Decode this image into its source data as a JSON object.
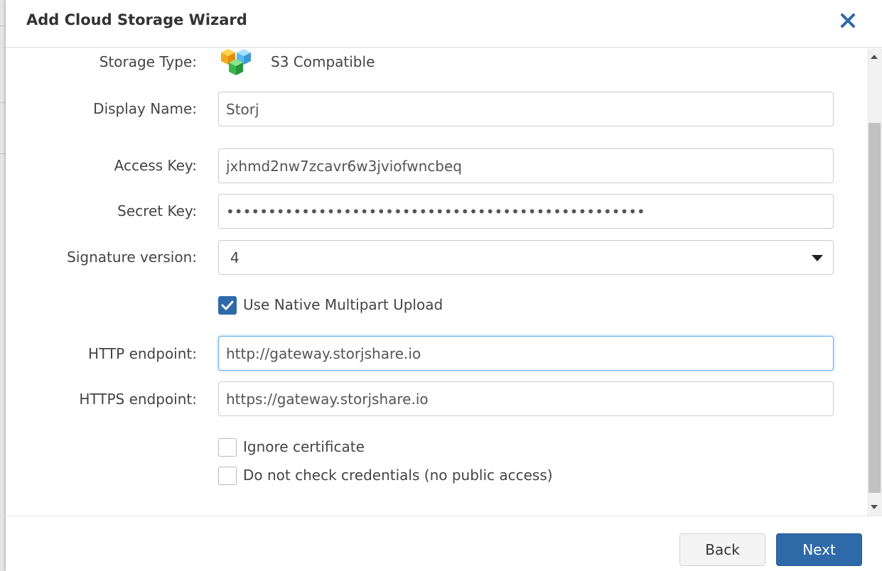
{
  "dialog": {
    "title": "Add Cloud Storage Wizard"
  },
  "form": {
    "storage_type": {
      "label": "Storage Type:",
      "value": "S3 Compatible",
      "icon": "s3-cubes-icon"
    },
    "display_name": {
      "label": "Display Name:",
      "value": "Storj"
    },
    "access_key": {
      "label": "Access Key:",
      "value": "jxhmd2nw7zcavr6w3jviofwncbeq"
    },
    "secret_key": {
      "label": "Secret Key:",
      "value": "••••••••••••••••••••••••••••••••••••••••••••••••••"
    },
    "signature_version": {
      "label": "Signature version:",
      "value": "4"
    },
    "native_multipart": {
      "label": "Use Native Multipart Upload",
      "checked": true
    },
    "http_endpoint": {
      "label": "HTTP endpoint:",
      "value": "http://gateway.storjshare.io"
    },
    "https_endpoint": {
      "label": "HTTPS endpoint:",
      "value": "https://gateway.storjshare.io"
    },
    "ignore_certificate": {
      "label": "Ignore certificate",
      "checked": false
    },
    "no_check_credentials": {
      "label": "Do not check credentials (no public access)",
      "checked": false
    }
  },
  "footer": {
    "back_label": "Back",
    "next_label": "Next"
  },
  "colors": {
    "primary": "#2e6aa8",
    "close_icon": "#2e6aa8",
    "focus_border": "#66afe9"
  }
}
